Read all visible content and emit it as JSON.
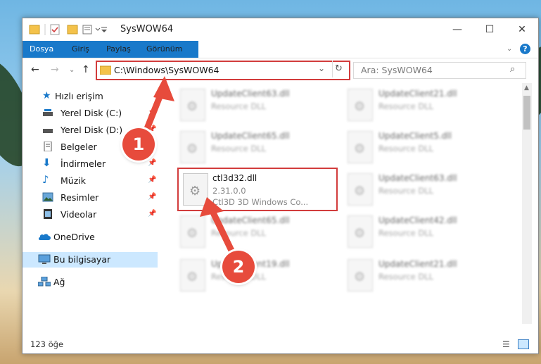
{
  "window": {
    "title": "SysWOW64",
    "controls": {
      "minimize": "—",
      "maximize": "☐",
      "close": "✕"
    }
  },
  "ribbon": {
    "tabs": [
      "Dosya",
      "Giriş",
      "Paylaş",
      "Görünüm"
    ],
    "help_icon": "question-icon"
  },
  "navigation": {
    "address": "C:\\Windows\\SysWOW64",
    "search_placeholder": "Ara: SysWOW64"
  },
  "sidebar": {
    "items": [
      {
        "label": "Hızlı erişim",
        "icon": "star-icon"
      },
      {
        "label": "Yerel Disk (C:)",
        "icon": "drive-icon"
      },
      {
        "label": "Yerel Disk (D:)",
        "icon": "drive-icon"
      },
      {
        "label": "Belgeler",
        "icon": "documents-icon"
      },
      {
        "label": "İndirmeler",
        "icon": "downloads-icon"
      },
      {
        "label": "Müzik",
        "icon": "music-icon"
      },
      {
        "label": "Resimler",
        "icon": "pictures-icon"
      },
      {
        "label": "Videolar",
        "icon": "videos-icon"
      },
      {
        "label": "OneDrive",
        "icon": "cloud-icon"
      },
      {
        "label": "Bu bilgisayar",
        "icon": "computer-icon"
      },
      {
        "label": "Ağ",
        "icon": "network-icon"
      }
    ]
  },
  "files": {
    "left": [
      {
        "name": "UpdateClient63.dll",
        "sub": "Resource DLL"
      },
      {
        "name": "UpdateClient65.dll",
        "sub": "Resource DLL"
      },
      {
        "name": "ctl3d32.dll",
        "sub": "2.31.0.0",
        "desc": "Ctl3D 3D Windows Co..."
      },
      {
        "name": "UpdateClient65.dll",
        "sub": "Resource DLL"
      },
      {
        "name": "UpdateClient19.dll",
        "sub": "Resource DLL"
      }
    ],
    "right": [
      {
        "name": "UpdateClient21.dll",
        "sub": "Resource DLL"
      },
      {
        "name": "UpdateClient5.dll",
        "sub": "Resource DLL"
      },
      {
        "name": "UpdateClient63.dll",
        "sub": "Resource DLL"
      },
      {
        "name": "UpdateClient42.dll",
        "sub": "Resource DLL"
      },
      {
        "name": "UpdateClient21.dll",
        "sub": "Resource DLL"
      }
    ]
  },
  "status": {
    "count": "123 öğe"
  },
  "annotations": {
    "badge1": "1",
    "badge2": "2",
    "color": "#e74b3c"
  }
}
